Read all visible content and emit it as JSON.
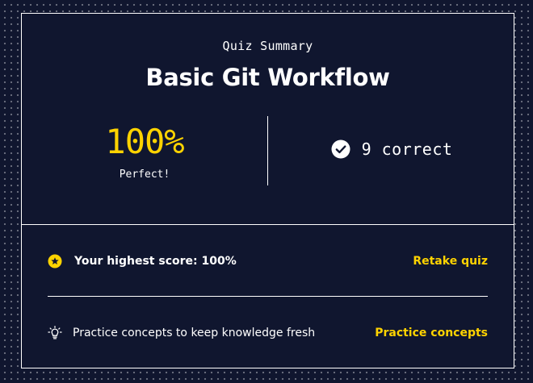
{
  "summary": {
    "eyebrow": "Quiz Summary",
    "title": "Basic Git Workflow",
    "score_percent": "100%",
    "score_label": "Perfect!",
    "correct_text": "9 correct"
  },
  "highest_score": {
    "icon": "star-badge-icon",
    "text": "Your highest score: 100%",
    "action_label": "Retake quiz"
  },
  "practice": {
    "icon": "lightbulb-icon",
    "text": "Practice concepts to keep knowledge fresh",
    "action_label": "Practice concepts"
  },
  "colors": {
    "background": "#10162f",
    "accent": "#ffd300",
    "text": "#ffffff"
  }
}
